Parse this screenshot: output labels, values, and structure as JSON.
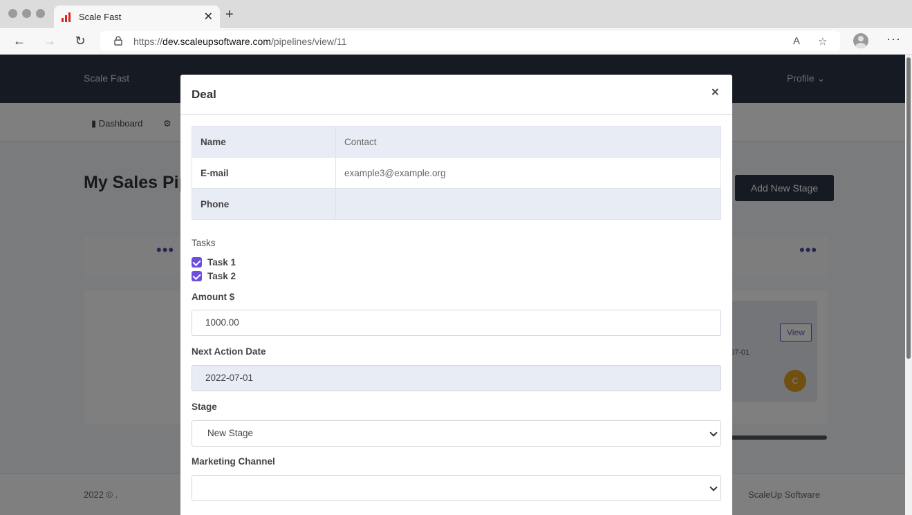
{
  "browser": {
    "tab_title": "Scale Fast",
    "url_scheme": "https://",
    "url_host": "dev.scaleupsoftware.com",
    "url_path": "/pipelines/view/11"
  },
  "app": {
    "brand": "Scale Fast",
    "profile_label": "Profile",
    "subnav": {
      "dashboard": "Dashboard"
    },
    "page_title": "My Sales Pip",
    "add_stage_label": "Add New Stage",
    "card": {
      "view_label": "View",
      "date_fragment": "07-01",
      "avatar_initial": "C"
    },
    "footer_left": "2022 © .",
    "footer_right": "ScaleUp Software"
  },
  "modal": {
    "title": "Deal",
    "info": {
      "name_label": "Name",
      "name_value": "Contact",
      "email_label": "E-mail",
      "email_value": "example3@example.org",
      "phone_label": "Phone",
      "phone_value": ""
    },
    "tasks_label": "Tasks",
    "tasks": [
      {
        "label": "Task 1",
        "checked": true
      },
      {
        "label": "Task 2",
        "checked": true
      }
    ],
    "amount_label": "Amount $",
    "amount_value": "1000.00",
    "next_action_label": "Next Action Date",
    "next_action_value": "2022-07-01",
    "stage_label": "Stage",
    "stage_value": "New Stage",
    "marketing_label": "Marketing Channel",
    "marketing_value": ""
  },
  "colors": {
    "nav_bg": "#2c3445",
    "accent": "#6c4fe0",
    "avatar": "#e0a020"
  }
}
